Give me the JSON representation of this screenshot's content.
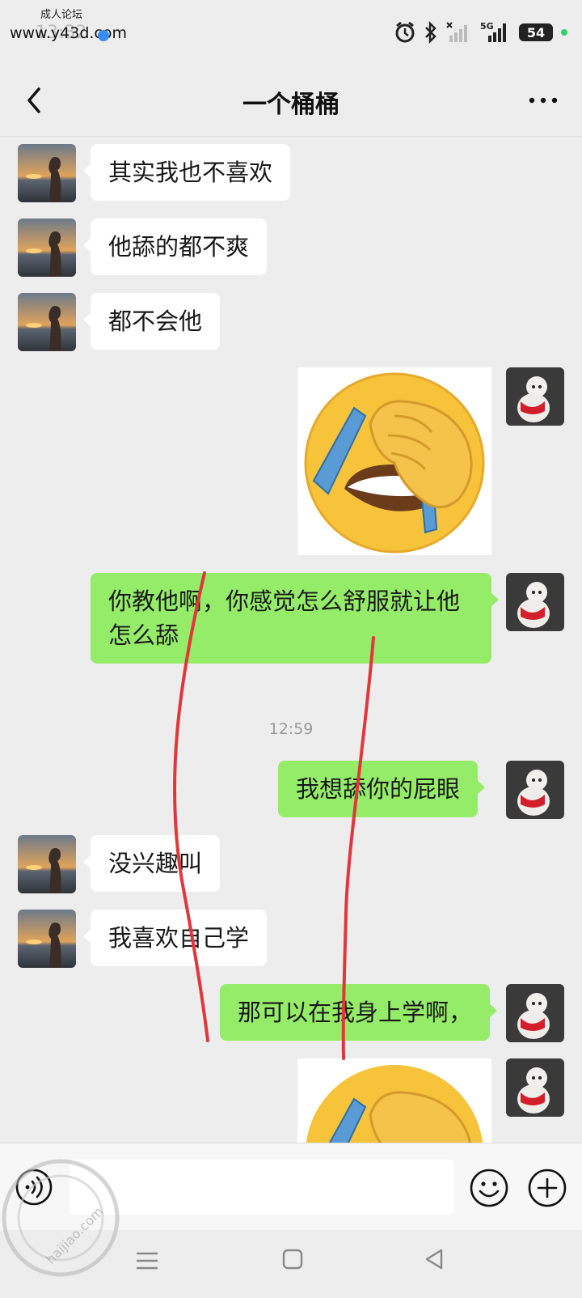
{
  "status_bar": {
    "watermark_top": "成人论坛",
    "watermark_url": "www.y43d.com",
    "time": "13:32",
    "battery": "54",
    "network": "5G",
    "icons": [
      "alarm-icon",
      "bluetooth-icon",
      "signal-icon",
      "battery-icon"
    ]
  },
  "header": {
    "title": "一个桶桶",
    "back_icon": "chevron-left-icon",
    "more_icon": "more-dots-icon"
  },
  "messages": [
    {
      "side": "in",
      "type": "text",
      "text": "其实我也不喜欢"
    },
    {
      "side": "in",
      "type": "text",
      "text": "他舔的都不爽"
    },
    {
      "side": "in",
      "type": "text",
      "text": "都不会他"
    },
    {
      "side": "out",
      "type": "sticker",
      "sticker": "facepalm-laugh-emoji"
    },
    {
      "side": "out",
      "type": "text",
      "text": "你教他啊，你感觉怎么舒服就让他怎么舔"
    },
    {
      "side": "out",
      "type": "text",
      "text": "我想舔你的屁眼"
    },
    {
      "side": "in",
      "type": "text",
      "text": "没兴趣叫"
    },
    {
      "side": "in",
      "type": "text",
      "text": "我喜欢自己学"
    },
    {
      "side": "out",
      "type": "text",
      "text": "那可以在我身上学啊，"
    },
    {
      "side": "out",
      "type": "sticker",
      "sticker": "facepalm-laugh-emoji"
    }
  ],
  "timestamp": "12:59",
  "input_bar": {
    "placeholder": "",
    "voice_icon": "voice-icon",
    "emoji_icon": "emoji-icon",
    "plus_icon": "plus-icon"
  },
  "watermark_stamp": "haijiao.com 海角社区",
  "colors": {
    "background": "#ededed",
    "outgoing_bubble": "#95ec69",
    "incoming_bubble": "#ffffff",
    "annotation_stroke": "#e0363c"
  }
}
